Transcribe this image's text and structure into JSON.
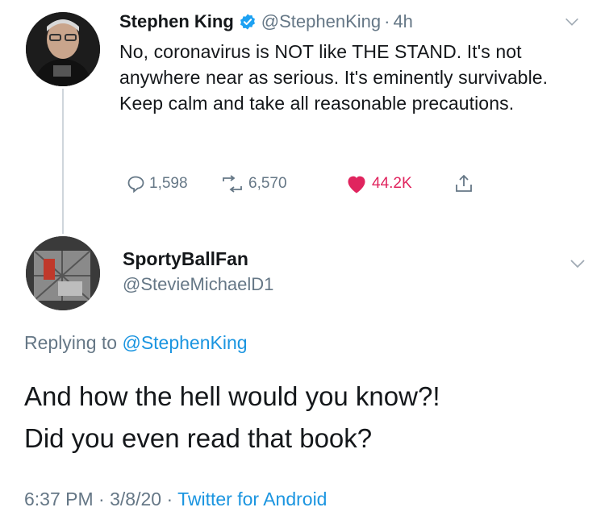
{
  "tweet": {
    "author_name": "Stephen King",
    "author_handle": "@StephenKing",
    "separator": "·",
    "age": "4h",
    "text": "No, coronavirus is NOT like THE STAND. It's not anywhere near as serious. It's eminently survivable. Keep calm and take all reasonable precautions.",
    "stats": {
      "replies": "1,598",
      "retweets": "6,570",
      "likes": "44.2K"
    },
    "verified": true
  },
  "reply": {
    "author_name": "SportyBallFan",
    "author_handle": "@StevieMichaelD1",
    "replying_prefix": "Replying to",
    "replying_to": "@StephenKing",
    "line1": "And how the hell would you know?!",
    "line2": "Did you even read that book?",
    "time": "6:37 PM",
    "date": "3/8/20",
    "source": "Twitter for Android",
    "sep": "·"
  },
  "colors": {
    "like": "#e0245e",
    "link": "#1b95e0",
    "muted": "#657786",
    "verified": "#1da1f2"
  }
}
